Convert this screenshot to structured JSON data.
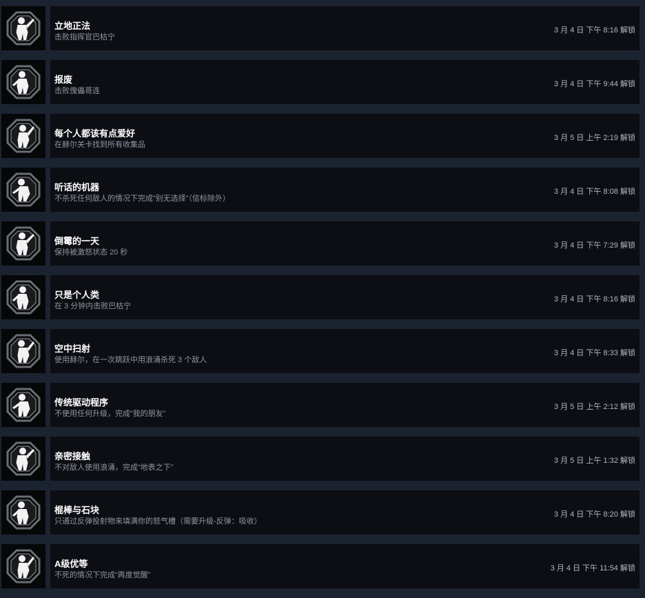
{
  "achievements": [
    {
      "title": "立地正法",
      "description": "击败指挥官巴枯宁",
      "unlock_time": "3 月 4 日 下午 8:16 解锁",
      "icon": "soldier-silhouette-icon"
    },
    {
      "title": "报废",
      "description": "击败傀儡哥连",
      "unlock_time": "3 月 4 日 下午 9:44 解锁",
      "icon": "robot-golem-icon"
    },
    {
      "title": "每个人都该有点爱好",
      "description": "在赫尔关卡找到所有收集品",
      "unlock_time": "3 月 5 日 上午 2:19 解锁",
      "icon": "masked-face-icon"
    },
    {
      "title": "听话的机器",
      "description": "不杀死任何敌人的情况下完成“别无选择”（信标除外）",
      "unlock_time": "3 月 4 日 下午 8:08 解锁",
      "icon": "saluting-robot-icon"
    },
    {
      "title": "倒霉的一天",
      "description": "保持被激怒状态 20 秒",
      "unlock_time": "3 月 4 日 下午 7:29 解锁",
      "icon": "running-figure-icon"
    },
    {
      "title": "只是个人类",
      "description": "在 3 分钟内击败巴枯宁",
      "unlock_time": "3 月 4 日 下午 8:16 解锁",
      "icon": "hand-grip-icon"
    },
    {
      "title": "空中扫射",
      "description": "使用赫尔，在一次跳跃中用浪涌杀死 3 个敌人",
      "unlock_time": "3 月 4 日 下午 8:33 解锁",
      "icon": "leaping-fighter-icon"
    },
    {
      "title": "传统驱动程序",
      "description": "不使用任何升级，完成“我的朋友”",
      "unlock_time": "3 月 5 日 上午 2:12 解锁",
      "icon": "crossed-robot-icon"
    },
    {
      "title": "亲密接触",
      "description": "不对敌人使用浪涌，完成“地表之下”",
      "unlock_time": "3 月 5 日 上午 1:32 解锁",
      "icon": "punching-fighter-icon"
    },
    {
      "title": "棍棒与石块",
      "description": "只通过反弹投射物来填满你的怒气槽（需要升级-反弹：吸收）",
      "unlock_time": "3 月 4 日 下午 8:20 解锁",
      "icon": "deflecting-fighter-icon"
    },
    {
      "title": "A级优等",
      "description": "不死的情况下完成“再度觉醒”",
      "unlock_time": "3 月 4 日 下午 11:54 解锁",
      "icon": "armored-head-icon"
    }
  ]
}
